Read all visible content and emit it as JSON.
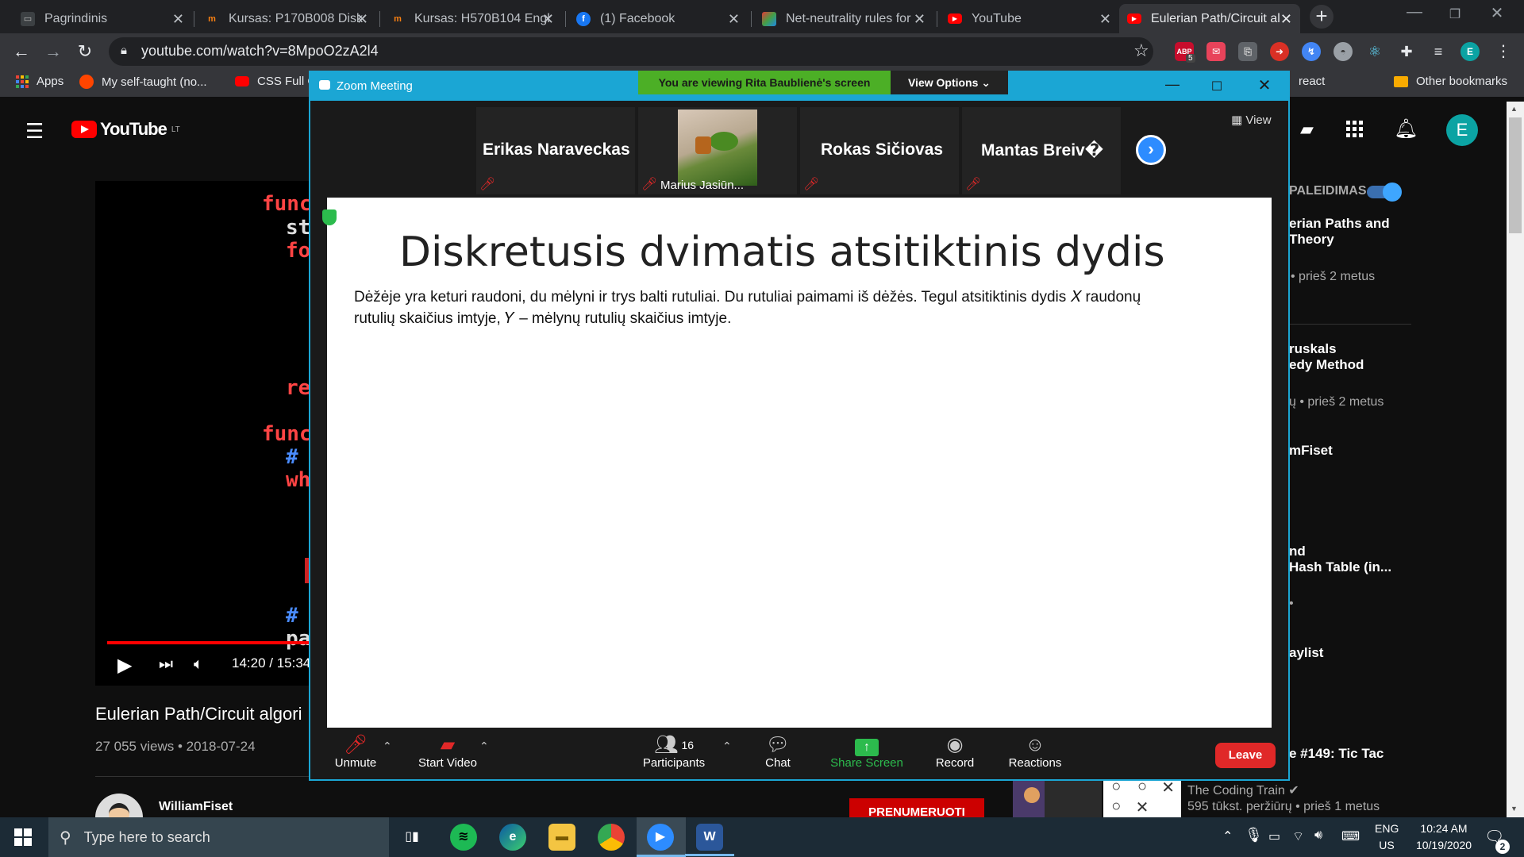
{
  "browser": {
    "tabs": [
      {
        "title": "Pagrindinis",
        "icon": "moodle-icon"
      },
      {
        "title": "Kursas: P170B008 Disk",
        "icon": "moodle-icon"
      },
      {
        "title": "Kursas: H570B104 Engl",
        "icon": "moodle-icon"
      },
      {
        "title": "(1) Facebook",
        "icon": "facebook-icon"
      },
      {
        "title": "Net-neutrality rules for",
        "icon": "news-icon"
      },
      {
        "title": "YouTube",
        "icon": "youtube-icon"
      },
      {
        "title": "Eulerian Path/Circuit al",
        "icon": "youtube-icon"
      }
    ],
    "url": "youtube.com/watch?v=8MpoO2zA2l4",
    "abp_count": "5",
    "profile_initial": "E",
    "bookmarks": [
      {
        "label": "Apps"
      },
      {
        "label": "My self-taught (no..."
      },
      {
        "label": "CSS Full C"
      },
      {
        "label": "react"
      },
      {
        "label": "Other bookmarks"
      }
    ]
  },
  "youtube": {
    "region": "LT",
    "logo_text": "YouTube",
    "profile_initial": "E",
    "video": {
      "time": "14:20 / 15:34",
      "title": "Eulerian Path/Circuit algori",
      "views": "27 055 views • 2018-07-24",
      "channel": "WilliamFiset",
      "subscribe": "PRENUMERUOTI",
      "code": [
        "func",
        "st",
        "fo",
        "re",
        "func",
        "#",
        "wh",
        "#",
        "pa"
      ]
    },
    "autoplay_label": "PALEIDIMAS",
    "sidebar": [
      {
        "title_lines": [
          "erian Paths and",
          "Theory"
        ],
        "meta": "• prieš 2 metus"
      },
      {
        "title_lines": [
          "ruskals",
          "edy Method"
        ],
        "meta": "ų • prieš 2 metus"
      },
      {
        "title_lines": [
          "mFiset"
        ],
        "meta": ""
      },
      {
        "title_lines": [
          "nd",
          "Hash Table (in..."
        ],
        "meta": "•"
      },
      {
        "title_lines": [
          "aylist"
        ],
        "meta": ""
      },
      {
        "title_lines": [
          "e #149: Tic Tac"
        ],
        "meta": ""
      }
    ],
    "coding_train": {
      "channel": "The Coding Train",
      "meta": "595 tūkst. peržiūrų • prieš 1 metus"
    }
  },
  "zoom": {
    "window_title": "Zoom Meeting",
    "banner": "You are viewing Rita Baublienė's screen",
    "view_options": "View Options ⌄",
    "view_label": "View",
    "participants": [
      {
        "name": "Erikas Naraveckas"
      },
      {
        "name": "Marius Jasiūn..."
      },
      {
        "name": "Rokas Sičiovas"
      },
      {
        "name": "Mantas Breiv�"
      }
    ],
    "slide": {
      "title": "Diskretusis dvimatis atsitiktinis dydis",
      "line1": "Dėžėje yra keturi raudoni, du mėlyni ir trys balti rutuliai. Du rutuliai paimami iš dėžės. Tegul atsitiktinis dydis 𝑋 raudonų",
      "line2": "rutulių skaičius imtyje, 𝑌 – mėlynų rutulių skaičius imtyje."
    },
    "toolbar": {
      "unmute": "Unmute",
      "start_video": "Start Video",
      "participants_count": "16",
      "participants": "Participants",
      "chat": "Chat",
      "share_screen": "Share Screen",
      "record": "Record",
      "reactions": "Reactions",
      "leave": "Leave"
    }
  },
  "taskbar": {
    "search_placeholder": "Type here to search",
    "lang": "ENG",
    "region": "US",
    "time": "10:24 AM",
    "date": "10/19/2020",
    "notification_count": "2"
  },
  "colors": {
    "zoom_blue": "#1ba6d4",
    "zoom_green": "#4caf26",
    "yt_red": "#ff0000",
    "leave_red": "#e02828"
  }
}
